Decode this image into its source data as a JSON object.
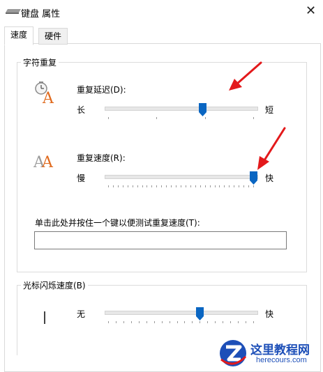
{
  "window": {
    "title": "键盘 属性",
    "close_glyph": "✕"
  },
  "tabs": [
    {
      "label": "速度",
      "active": true
    },
    {
      "label": "硬件",
      "active": false
    }
  ],
  "repeat_group": {
    "label": "字符重复",
    "delay": {
      "label": "重复延迟(D):",
      "left_label": "长",
      "right_label": "短",
      "value_fraction": 0.65,
      "tick_count": 4
    },
    "rate": {
      "label": "重复速度(R):",
      "left_label": "慢",
      "right_label": "快",
      "value_fraction": 1.0,
      "tick_count": 31
    },
    "test": {
      "label": "单击此处并按住一个键以便测试重复速度(T):",
      "value": ""
    }
  },
  "cursor_group": {
    "label": "光标闪烁速度(B)",
    "left_label": "无",
    "right_label": "快",
    "value_fraction": 0.63,
    "tick_count": 20
  },
  "watermark": {
    "title": "这里教程网",
    "url": "herecours.com"
  },
  "colors": {
    "thumb": "#0a66c2",
    "arrow": "#e3191b",
    "icon_orange": "#e06b1f"
  }
}
